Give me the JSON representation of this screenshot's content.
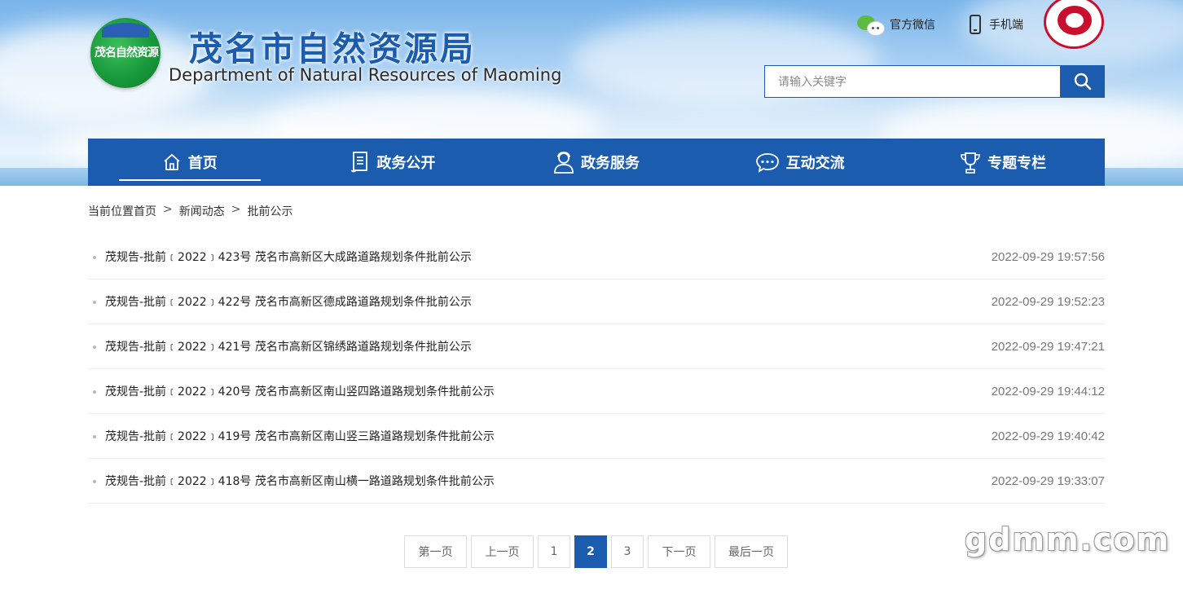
{
  "header": {
    "logo_text": "茂名自然资源",
    "title": "茂名市自然资源局",
    "subtitle": "Department of Natural Resources of Maoming",
    "wechat_label": "官方微信",
    "mobile_label": "手机端",
    "search_placeholder": "请输入关键字"
  },
  "nav": {
    "items": [
      {
        "label": "首页",
        "icon": "home-icon"
      },
      {
        "label": "政务公开",
        "icon": "document-icon"
      },
      {
        "label": "政务服务",
        "icon": "service-person-icon"
      },
      {
        "label": "互动交流",
        "icon": "chat-bubble-icon"
      },
      {
        "label": "专题专栏",
        "icon": "trophy-icon"
      }
    ],
    "active_index": 0
  },
  "breadcrumb": {
    "prefix": "当前位置首页",
    "sep": ">",
    "items": [
      "新闻动态",
      "批前公示"
    ]
  },
  "articles": [
    {
      "title": "茂规告-批前﹝2022﹞423号 茂名市高新区大成路道路规划条件批前公示",
      "date": "2022-09-29 19:57:56"
    },
    {
      "title": "茂规告-批前﹝2022﹞422号 茂名市高新区德成路道路规划条件批前公示",
      "date": "2022-09-29 19:52:23"
    },
    {
      "title": "茂规告-批前﹝2022﹞421号 茂名市高新区锦绣路道路规划条件批前公示",
      "date": "2022-09-29 19:47:21"
    },
    {
      "title": "茂规告-批前﹝2022﹞420号 茂名市高新区南山竖四路道路规划条件批前公示",
      "date": "2022-09-29 19:44:12"
    },
    {
      "title": "茂规告-批前﹝2022﹞419号 茂名市高新区南山竖三路道路规划条件批前公示",
      "date": "2022-09-29 19:40:42"
    },
    {
      "title": "茂规告-批前﹝2022﹞418号 茂名市高新区南山横一路道路规划条件批前公示",
      "date": "2022-09-29 19:33:07"
    }
  ],
  "pagination": {
    "first": "第一页",
    "prev": "上一页",
    "pages": [
      "1",
      "2",
      "3"
    ],
    "current_page": "2",
    "next": "下一页",
    "last": "最后一页"
  },
  "watermark": "gdmm.com",
  "colors": {
    "primary": "#1b5cae",
    "logo_green": "#18993b",
    "seal_red": "#c8102e"
  }
}
